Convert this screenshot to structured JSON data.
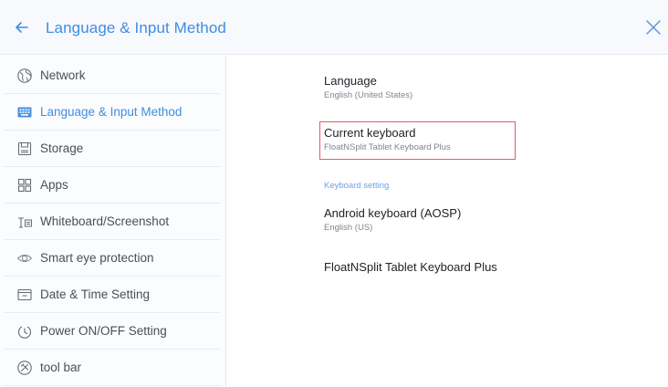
{
  "header": {
    "back_icon": "arrow-left-icon",
    "title": "Language & Input Method",
    "close_icon": "close-icon"
  },
  "colors": {
    "accent": "#3f8de3",
    "highlight_border": "#e35a6a",
    "header_bg": "#f7f9fc",
    "text": "#4a4f56"
  },
  "sidebar": {
    "items": [
      {
        "label": "Network",
        "icon": "globe-icon",
        "active": false
      },
      {
        "label": "Language & Input Method",
        "icon": "keyboard-icon",
        "active": true
      },
      {
        "label": "Storage",
        "icon": "storage-icon",
        "active": false
      },
      {
        "label": "Apps",
        "icon": "apps-icon",
        "active": false
      },
      {
        "label": "Whiteboard/Screenshot",
        "icon": "whiteboard-icon",
        "active": false
      },
      {
        "label": "Smart eye protection",
        "icon": "eye-icon",
        "active": false
      },
      {
        "label": "Date & Time Setting",
        "icon": "calendar-icon",
        "active": false
      },
      {
        "label": "Power ON/OFF Setting",
        "icon": "power-icon",
        "active": false
      },
      {
        "label": "tool bar",
        "icon": "toolbar-icon",
        "active": false
      }
    ]
  },
  "main": {
    "language": {
      "title": "Language",
      "value": "English (United States)"
    },
    "current_keyboard": {
      "title": "Current keyboard",
      "value": "FloatNSplit Tablet Keyboard Plus"
    },
    "section_label": "Keyboard setting",
    "keyboards": [
      {
        "title": "Android keyboard (AOSP)",
        "value": "English (US)"
      },
      {
        "title": "FloatNSplit Tablet Keyboard Plus",
        "value": ""
      }
    ]
  }
}
